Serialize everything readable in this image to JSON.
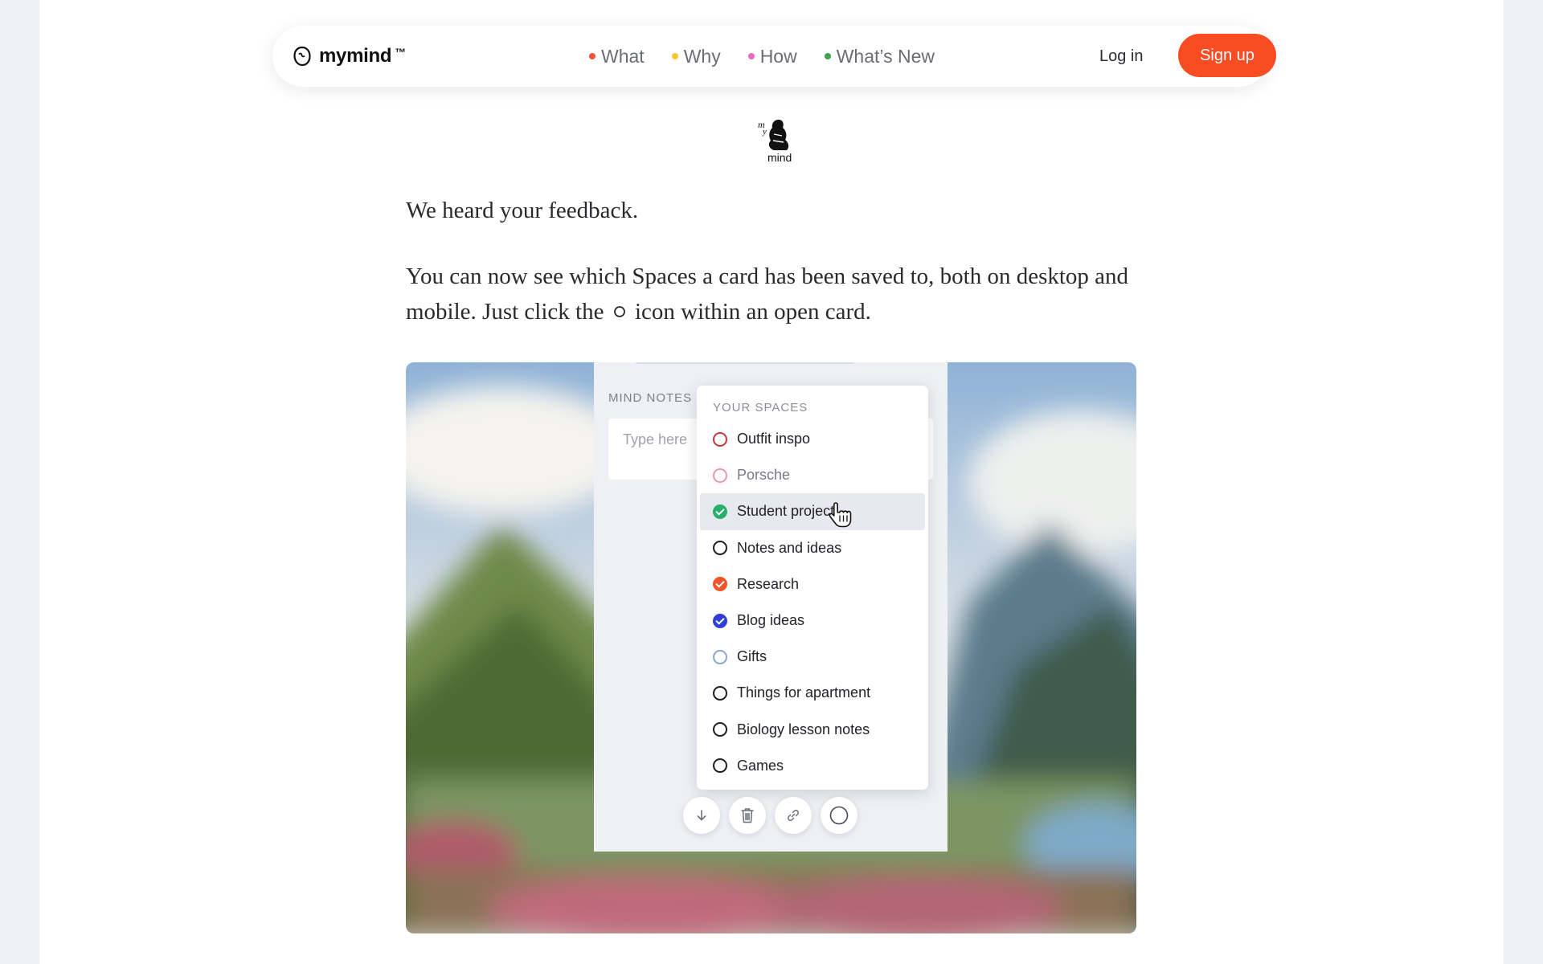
{
  "colors": {
    "accent": "#fa4c22",
    "nav_dot_what": "#f0553a",
    "nav_dot_why": "#f2c531",
    "nav_dot_how": "#e86ac0",
    "nav_dot_whats_new": "#3fa14d"
  },
  "nav": {
    "brand": {
      "name": "mymind",
      "tm": "™",
      "icon": "brain-logo-icon"
    },
    "links": [
      {
        "label": "What",
        "dot_color": "#f0553a"
      },
      {
        "label": "Why",
        "dot_color": "#f2c531"
      },
      {
        "label": "How",
        "dot_color": "#e86ac0"
      },
      {
        "label": "What’s New",
        "dot_color": "#3fa14d"
      }
    ],
    "login": "Log in",
    "signup": "Sign up"
  },
  "emblem": {
    "text": "mind",
    "icon": "my-mind-emblem-icon"
  },
  "article": {
    "p1": "We heard your feedback.",
    "p2_before": "You can now see which Spaces a card has been saved to, both on desktop and mobile. Just click the",
    "p2_icon": "circle-icon",
    "p2_after": "icon within an open card."
  },
  "media": {
    "mind_notes_label": "MIND NOTES",
    "note_placeholder": "Type here",
    "spaces": {
      "header": "YOUR SPACES",
      "items": [
        {
          "label": "Outfit inspo",
          "ring_color": "#c8363a",
          "checked": false
        },
        {
          "label": "Porsche",
          "ring_color": "#e79aa6",
          "checked": false,
          "muted": true
        },
        {
          "label": "Student project",
          "ring_color": "#22b06a",
          "checked": true,
          "hovered": true
        },
        {
          "label": "Notes and ideas",
          "ring_color": "#1d1d22",
          "checked": false
        },
        {
          "label": "Research",
          "ring_color": "#f0552a",
          "checked": true
        },
        {
          "label": "Blog ideas",
          "ring_color": "#2f3ed6",
          "checked": true
        },
        {
          "label": "Gifts",
          "ring_color": "#8ea2d0",
          "checked": false
        },
        {
          "label": "Things for apartment",
          "ring_color": "#1d1d22",
          "checked": false
        },
        {
          "label": "Biology lesson notes",
          "ring_color": "#1d1d22",
          "checked": false
        },
        {
          "label": "Games",
          "ring_color": "#1d1d22",
          "checked": false
        }
      ]
    },
    "tools": [
      "download-icon",
      "trash-icon",
      "link-icon",
      "spaces-circle-icon"
    ]
  }
}
